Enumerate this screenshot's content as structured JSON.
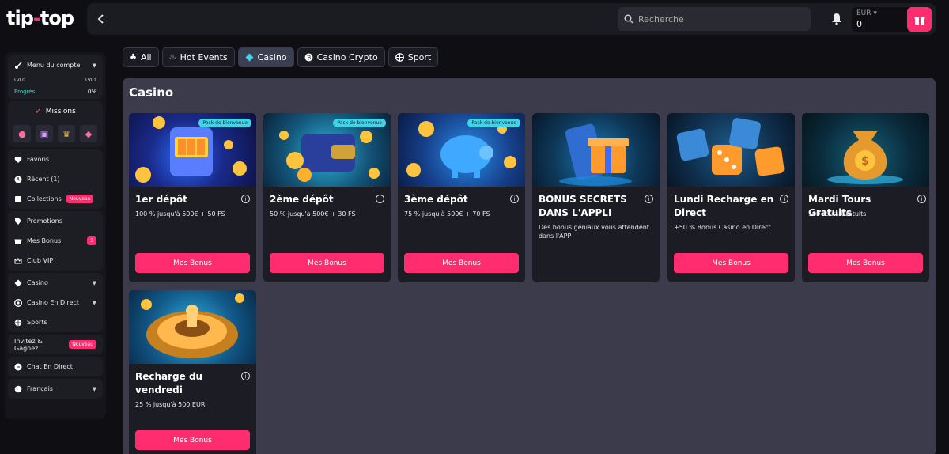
{
  "brand": {
    "logo_a": "tip",
    "logo_dash": "-",
    "logo_b": "top"
  },
  "header": {
    "search_placeholder": "Recherche",
    "currency": "EUR",
    "balance": "0"
  },
  "sidebar": {
    "account_menu": "Menu du compte",
    "lvl_from": "LVL0",
    "lvl_to": "LVL1",
    "progress_label": "Progrès",
    "progress_value": "0%",
    "missions": "Missions",
    "favoris": "Favoris",
    "recent": "Récent (1)",
    "collections": "Collections",
    "new_badge": "Nouveau",
    "promotions": "Promotions",
    "mes_bonus": "Mes Bonus",
    "mes_bonus_count": "3",
    "club_vip": "Club VIP",
    "casino": "Casino",
    "casino_direct": "Casino En Direct",
    "sports": "Sports",
    "invite": "Invitez & Gagnez",
    "chat": "Chat En Direct",
    "language": "Français"
  },
  "tabs": [
    {
      "label": "All"
    },
    {
      "label": "Hot Events"
    },
    {
      "label": "Casino"
    },
    {
      "label": "Casino Crypto"
    },
    {
      "label": "Sport"
    }
  ],
  "panel_title": "Casino",
  "pack_label": "Pack de bienvenue",
  "button_label": "Mes Bonus",
  "cards": [
    {
      "title": "1er dépôt",
      "desc": "100 % jusqu'à 500€ + 50 FS"
    },
    {
      "title": "2ème dépôt",
      "desc": "50 % jusqu'à 500€ + 30 FS"
    },
    {
      "title": "3ème dépôt",
      "desc": "75 % jusqu'à 500€ + 70 FS"
    },
    {
      "title": "BONUS SECRETS DANS L'APPLI",
      "desc": "Des bonus géniaux vous attendent dans l'APP"
    },
    {
      "title": "Lundi Recharge en Direct",
      "desc": "+50 % Bonus Casino en Direct"
    },
    {
      "title": "Mardi Tours Gratuits",
      "desc": "100 Tours Gratuits"
    },
    {
      "title": "Recharge du vendredi",
      "desc": "25 % jusqu'à 500 EUR"
    }
  ],
  "colors": {
    "accent": "#ff2d6f",
    "teal": "#3fd4c3",
    "panel": "#3b3b4c"
  }
}
